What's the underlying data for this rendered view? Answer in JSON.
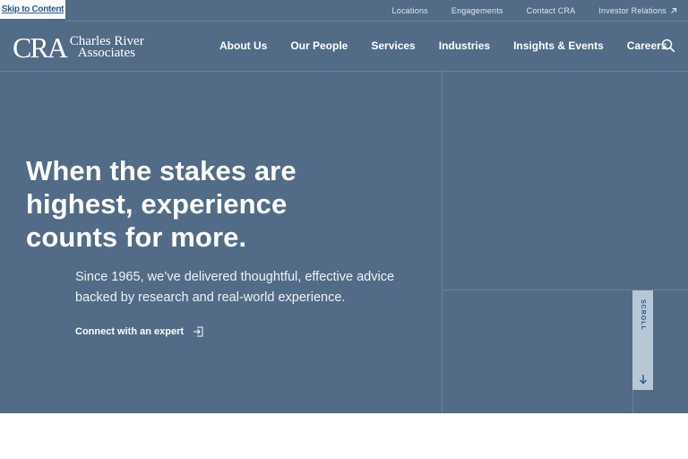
{
  "skip_link": "Skip to Content",
  "utility_nav": {
    "items": [
      "Locations",
      "Engagements",
      "Contact CRA",
      "Investor Relations"
    ],
    "external_icon": "external-arrow-icon"
  },
  "logo": {
    "mark": "CRA",
    "line1": "Charles River",
    "line2": "Associates"
  },
  "main_nav": {
    "items": [
      "About Us",
      "Our People",
      "Services",
      "Industries",
      "Insights & Events",
      "Careers"
    ],
    "search_icon": "search-icon"
  },
  "hero": {
    "headline_line1": "When the stakes are",
    "headline_line2": "highest, experience",
    "headline_line3": "counts for more.",
    "subtext_line1": "Since 1965, we’ve delivered thoughtful, effective advice",
    "subtext_line2": "backed by research and real-world experience.",
    "cta_label": "Connect with an expert",
    "cta_icon": "arrow-right-box-icon"
  },
  "scroll": {
    "label": "SCROLL",
    "icon": "arrow-down-icon"
  },
  "colors": {
    "hero_bg": "#526b87",
    "accent_blue": "#2a5a8c",
    "scroll_tab": "#b8c7d6"
  }
}
